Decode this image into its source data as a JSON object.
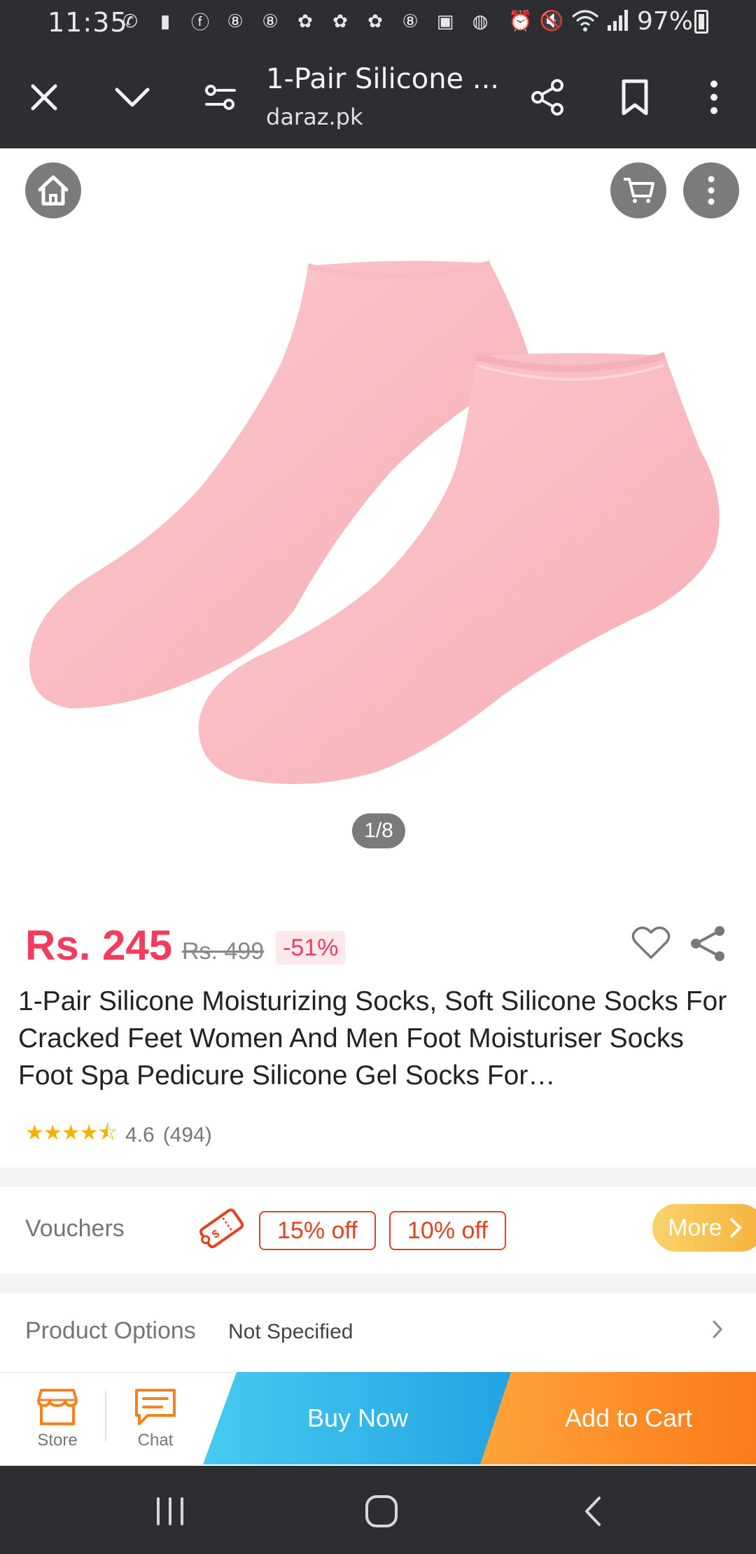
{
  "status_bar": {
    "time": "11:35",
    "battery": "97%",
    "notification_icons": [
      "whatsapp-icon",
      "message-icon",
      "facebook-icon",
      "app-icon",
      "app-icon",
      "chat-bubble-icon",
      "chat-bubble-icon",
      "chat-bubble-icon",
      "app-icon",
      "gallery-icon",
      "shopping-bag-icon"
    ],
    "system_icons": [
      "alarm-icon",
      "mute-icon",
      "wifi-icon",
      "signal-icon"
    ]
  },
  "browser": {
    "title": "1-Pair Silicone ...",
    "domain": "daraz.pk"
  },
  "gallery": {
    "pager": "1/8"
  },
  "product": {
    "price": "Rs. 245",
    "original_price": "Rs. 499",
    "discount": "-51%",
    "title": "1-Pair Silicone Moisturizing Socks, Soft Silicone Socks For Cracked Feet Women And Men Foot Moisturiser Socks Foot Spa Pedicure Silicone Gel Socks For…",
    "rating_stars": "★★★★⯪",
    "rating": "4.6",
    "review_count": "(494)",
    "accent_color": "#f23c5f"
  },
  "vouchers": {
    "label": "Vouchers",
    "chips": [
      "15% off",
      "10% off"
    ],
    "more": "More"
  },
  "options": {
    "label": "Product Options",
    "value": "Not Specified"
  },
  "bottom_bar": {
    "store": "Store",
    "chat": "Chat",
    "buy_now": "Buy Now",
    "add_to_cart": "Add to Cart"
  }
}
